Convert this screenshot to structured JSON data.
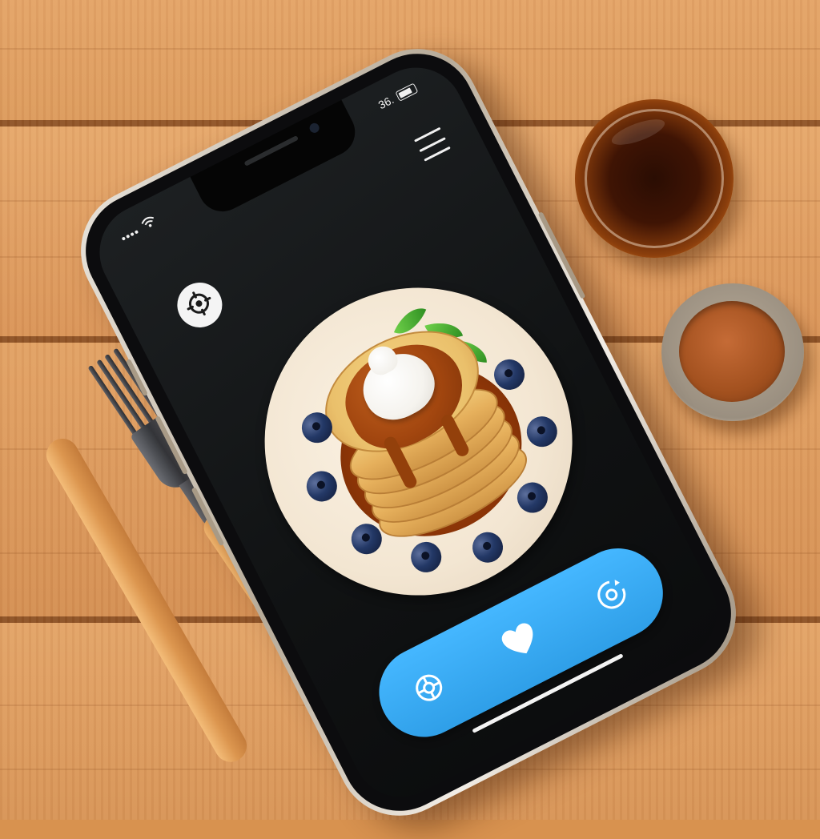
{
  "scene": {
    "table": "wooden-table",
    "syrup_jar": "maple-syrup-jar",
    "spice_bowl": "cinnamon-bowl",
    "fork": "fork",
    "knife": "wooden-knife"
  },
  "status_bar": {
    "left_text": "",
    "right_text": "36."
  },
  "screen": {
    "menu_button_icon": "gear-icon",
    "hamburger_icon": "hamburger-menu-icon",
    "content_image": "pancake-stack-with-syrup-cream-and-blueberries"
  },
  "action_bar": {
    "color": "#3aaaf5",
    "buttons": [
      {
        "icon": "target-icon"
      },
      {
        "icon": "heart-icon"
      },
      {
        "icon": "refresh-icon"
      }
    ]
  },
  "colors": {
    "phone_bezel": "#0c0c0e",
    "screen_bg": "#141618",
    "plate": "#f3e6d2",
    "syrup": "#a2460f",
    "accent_blue": "#3aaaf5"
  }
}
